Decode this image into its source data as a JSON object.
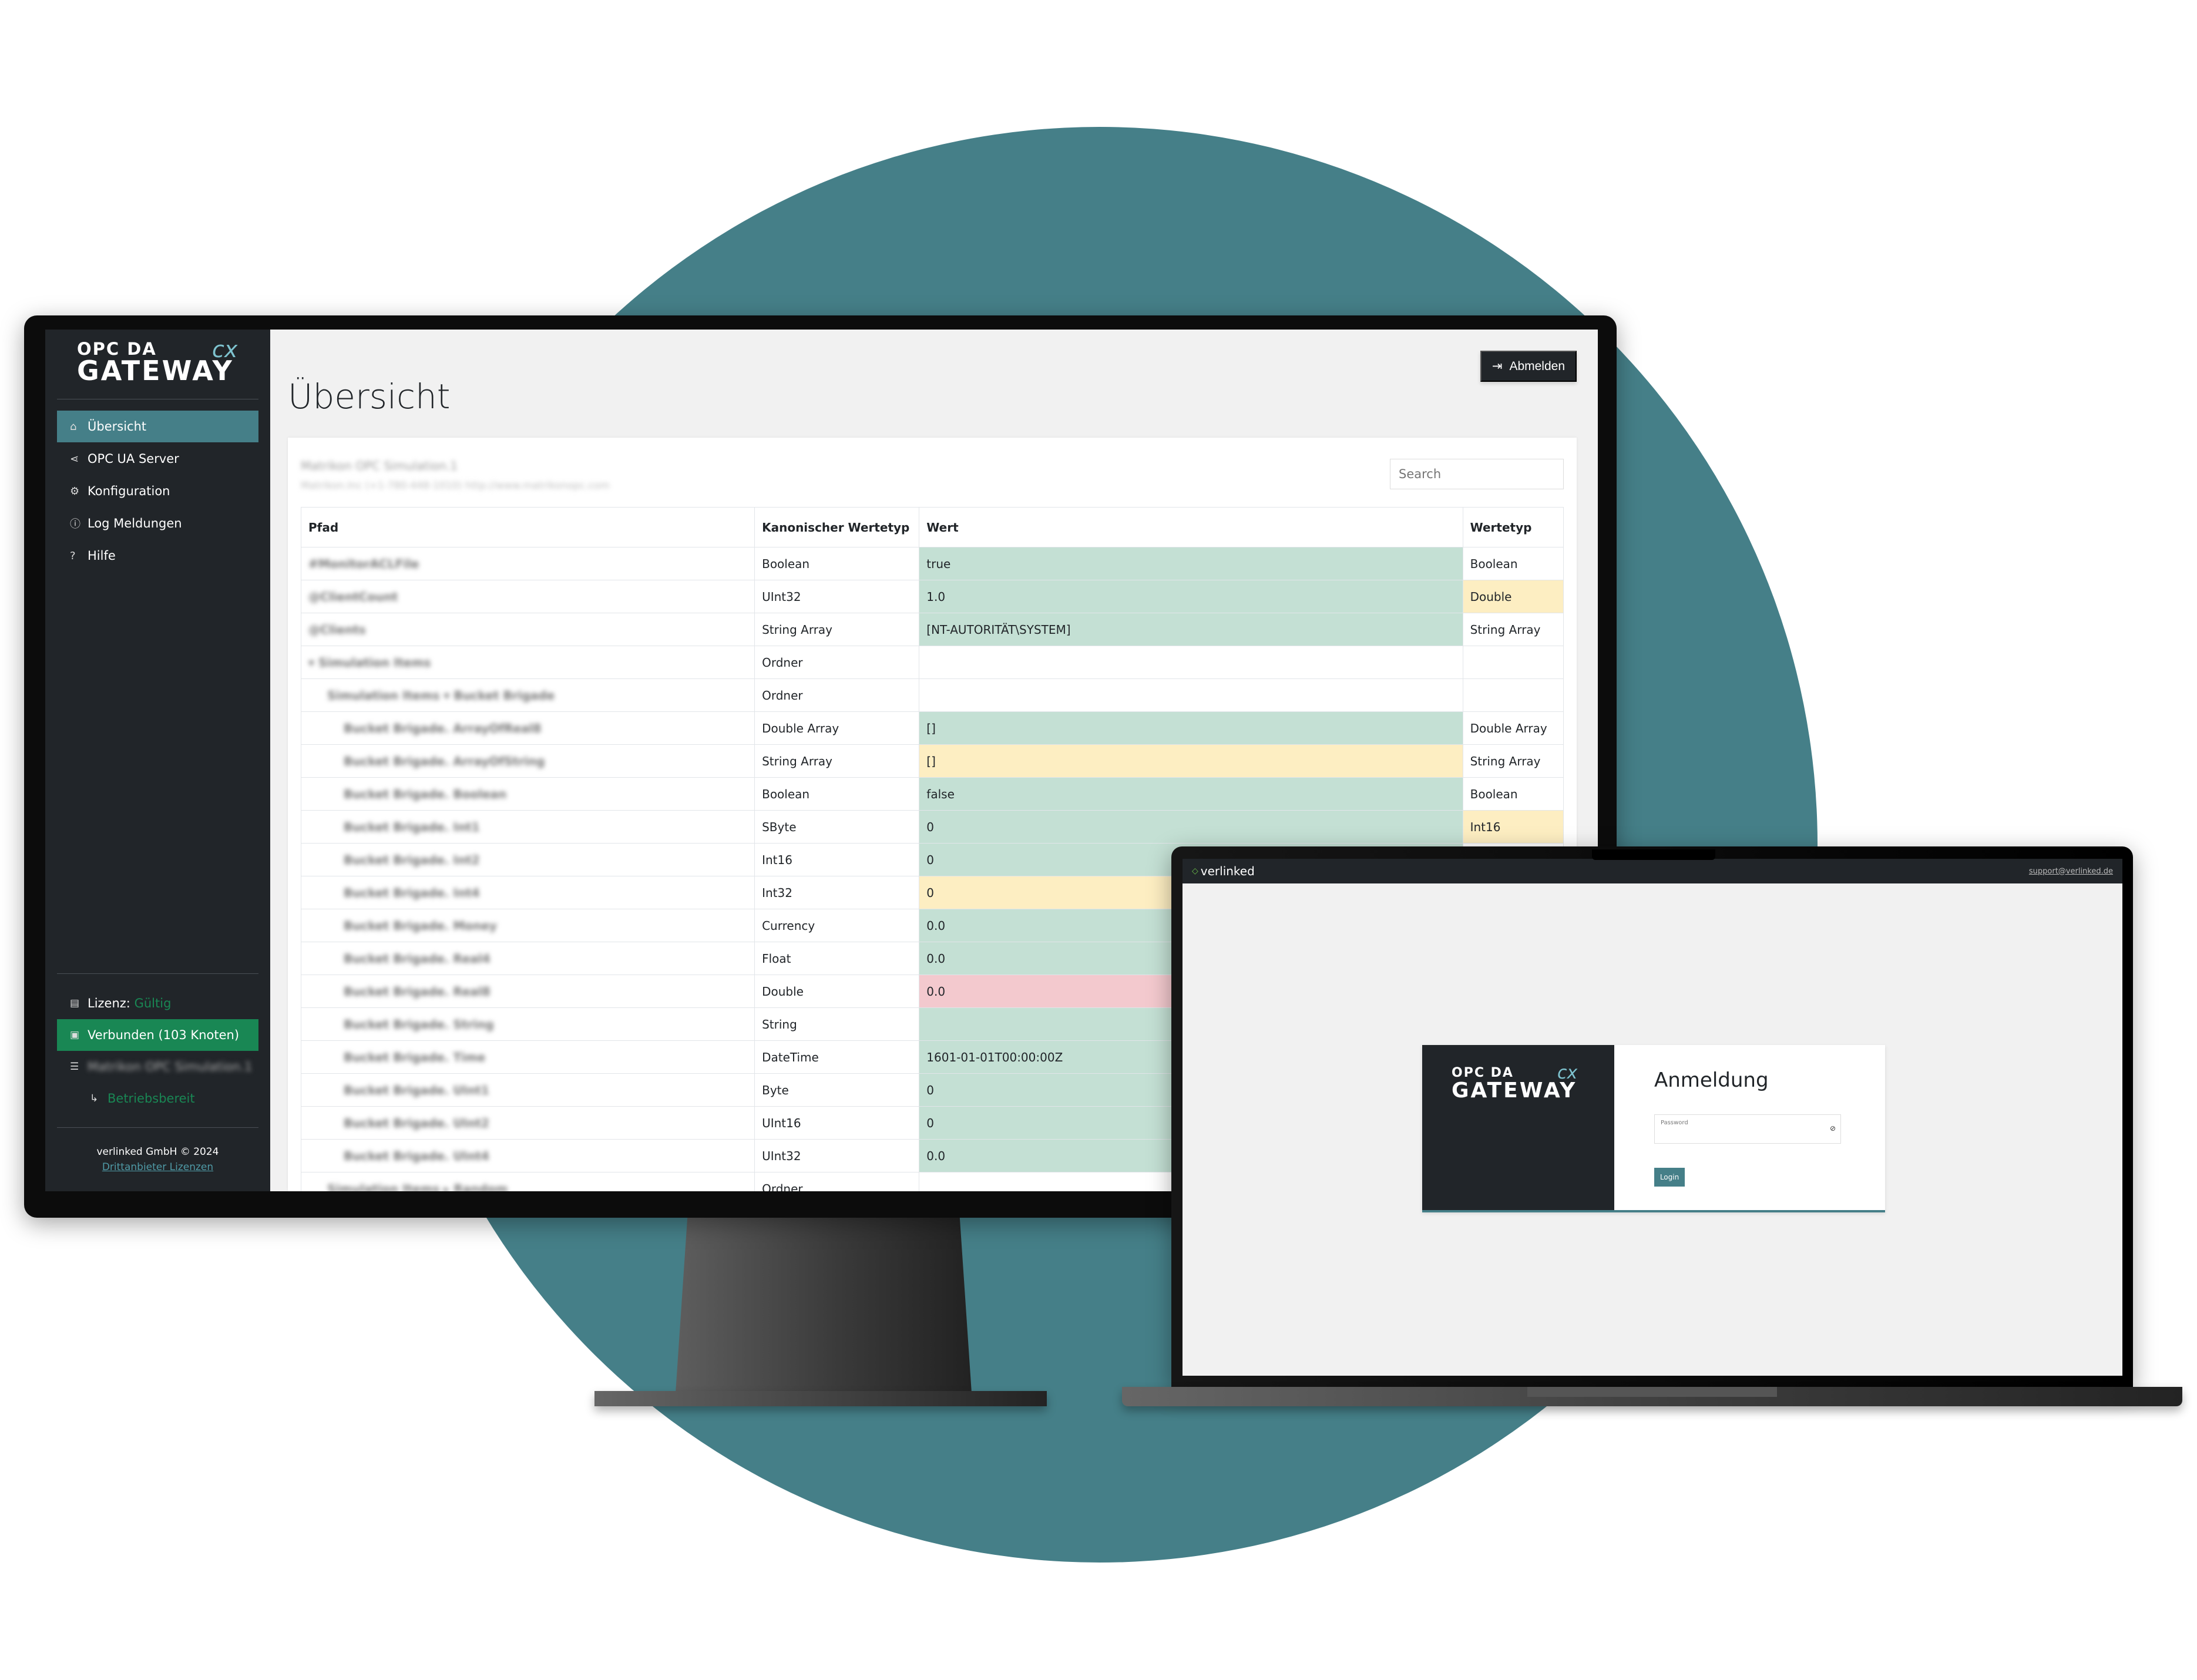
{
  "monitor": {
    "sidebar": {
      "logo": {
        "line1": "OPC DA",
        "line2": "GATEWAY",
        "suffix": "cx"
      },
      "nav": [
        {
          "label": "Übersicht",
          "icon": "home-icon",
          "glyph": "⌂",
          "active": true
        },
        {
          "label": "OPC UA Server",
          "icon": "share-icon",
          "glyph": "⋖",
          "active": false
        },
        {
          "label": "Konfiguration",
          "icon": "gear-icon",
          "glyph": "⚙",
          "active": false
        },
        {
          "label": "Log Meldungen",
          "icon": "alert-circle-icon",
          "glyph": "ⓘ",
          "active": false
        },
        {
          "label": "Hilfe",
          "icon": "help-icon",
          "glyph": "?",
          "active": false
        }
      ],
      "license_label": "Lizenz:",
      "license_status": "Gültig",
      "connected_label": "Verbunden (103 Knoten)",
      "server_name": "Matrikon OPC Simulation.1",
      "server_state": "Betriebsbereit",
      "copyright": "verlinked GmbH © 2024",
      "third_party_link": "Drittanbieter Lizenzen"
    },
    "header": {
      "logout_label": "Abmelden",
      "page_title": "Übersicht"
    },
    "card": {
      "server_title": "Matrikon OPC Simulation.1",
      "server_subtitle": "Matrikon.Inc (+1-780-448-1010) http://www.matrikonopc.com",
      "search_placeholder": "Search"
    },
    "table": {
      "columns": [
        "Pfad",
        "Kanonischer Wertetyp",
        "Wert",
        "Wertetyp"
      ],
      "rows": [
        {
          "path": "#MonitorACLFile",
          "indent": 0,
          "canonical": "Boolean",
          "value": "true",
          "value_state": "success",
          "type": "Boolean",
          "type_state": ""
        },
        {
          "path": "@ClientCount",
          "indent": 0,
          "canonical": "UInt32",
          "value": "1.0",
          "value_state": "success",
          "type": "Double",
          "type_state": "warning"
        },
        {
          "path": "@Clients",
          "indent": 0,
          "canonical": "String Array",
          "value": "[NT-AUTORITÄT\\SYSTEM]",
          "value_state": "success",
          "type": "String Array",
          "type_state": ""
        },
        {
          "path": "▾ Simulation Items",
          "indent": 0,
          "canonical": "Ordner",
          "value": "",
          "value_state": "",
          "type": "",
          "type_state": ""
        },
        {
          "path": "Simulation Items ▾ Bucket Brigade",
          "indent": 1,
          "canonical": "Ordner",
          "value": "",
          "value_state": "",
          "type": "",
          "type_state": ""
        },
        {
          "path": "Bucket Brigade. ArrayOfReal8",
          "indent": 2,
          "canonical": "Double Array",
          "value": "[]",
          "value_state": "success",
          "type": "Double Array",
          "type_state": ""
        },
        {
          "path": "Bucket Brigade. ArrayOfString",
          "indent": 2,
          "canonical": "String Array",
          "value": "[]",
          "value_state": "warning",
          "type": "String Array",
          "type_state": ""
        },
        {
          "path": "Bucket Brigade. Boolean",
          "indent": 2,
          "canonical": "Boolean",
          "value": "false",
          "value_state": "success",
          "type": "Boolean",
          "type_state": ""
        },
        {
          "path": "Bucket Brigade. Int1",
          "indent": 2,
          "canonical": "SByte",
          "value": "0",
          "value_state": "success",
          "type": "Int16",
          "type_state": "warning"
        },
        {
          "path": "Bucket Brigade. Int2",
          "indent": 2,
          "canonical": "Int16",
          "value": "0",
          "value_state": "success",
          "type": "",
          "type_state": ""
        },
        {
          "path": "Bucket Brigade. Int4",
          "indent": 2,
          "canonical": "Int32",
          "value": "0",
          "value_state": "warning",
          "type": "",
          "type_state": ""
        },
        {
          "path": "Bucket Brigade. Money",
          "indent": 2,
          "canonical": "Currency",
          "value": "0.0",
          "value_state": "success",
          "type": "",
          "type_state": ""
        },
        {
          "path": "Bucket Brigade. Real4",
          "indent": 2,
          "canonical": "Float",
          "value": "0.0",
          "value_state": "success",
          "type": "",
          "type_state": ""
        },
        {
          "path": "Bucket Brigade. Real8",
          "indent": 2,
          "canonical": "Double",
          "value": "0.0",
          "value_state": "danger",
          "type": "",
          "type_state": ""
        },
        {
          "path": "Bucket Brigade. String",
          "indent": 2,
          "canonical": "String",
          "value": "",
          "value_state": "success",
          "type": "",
          "type_state": ""
        },
        {
          "path": "Bucket Brigade. Time",
          "indent": 2,
          "canonical": "DateTime",
          "value": "1601-01-01T00:00:00Z",
          "value_state": "success",
          "type": "",
          "type_state": ""
        },
        {
          "path": "Bucket Brigade. UInt1",
          "indent": 2,
          "canonical": "Byte",
          "value": "0",
          "value_state": "success",
          "type": "",
          "type_state": ""
        },
        {
          "path": "Bucket Brigade. UInt2",
          "indent": 2,
          "canonical": "UInt16",
          "value": "0",
          "value_state": "success",
          "type": "",
          "type_state": ""
        },
        {
          "path": "Bucket Brigade. UInt4",
          "indent": 2,
          "canonical": "UInt32",
          "value": "0.0",
          "value_state": "success",
          "type": "",
          "type_state": ""
        },
        {
          "path": "Simulation Items ▸ Random",
          "indent": 1,
          "canonical": "Ordner",
          "value": "",
          "value_state": "",
          "type": "",
          "type_state": ""
        }
      ]
    }
  },
  "laptop": {
    "topbar": {
      "brand": "verlinked",
      "support_link": "support@verlinked.de"
    },
    "login": {
      "logo": {
        "line1": "OPC DA",
        "line2": "GATEWAY",
        "suffix": "cx"
      },
      "title": "Anmeldung",
      "password_label": "Password",
      "login_button": "Login"
    }
  },
  "colors": {
    "accent": "#457f88",
    "sidebar_bg": "#212529",
    "success": "#198754",
    "cell_success": "#c4e0d4",
    "cell_warning": "#fdeec2",
    "cell_danger": "#f3c9ce"
  }
}
